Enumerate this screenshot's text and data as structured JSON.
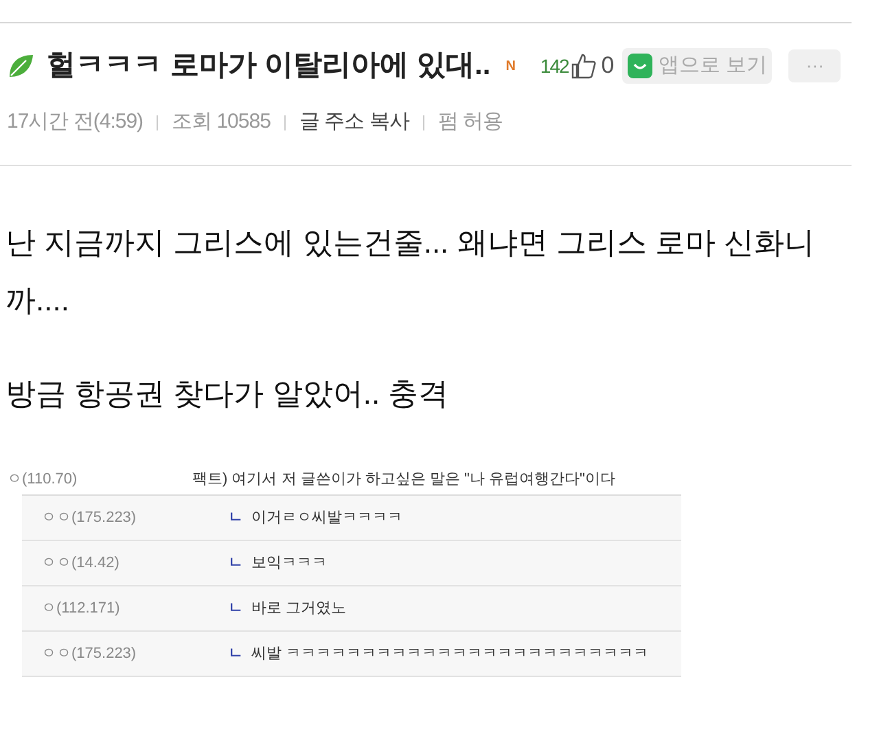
{
  "post": {
    "title": "헐ㅋㅋㅋ 로마가 이탈리아에 있대..",
    "new_badge": "N",
    "like_count": "142",
    "dislike_count": "0",
    "app_button": "앱으로 보기",
    "more_button": "···",
    "meta": [
      {
        "text": "17시간 전(4:59)",
        "kind": "plain"
      },
      {
        "text": "조회 10585",
        "kind": "plain"
      },
      {
        "text": "글 주소 복사",
        "kind": "link"
      },
      {
        "text": "펌 허용",
        "kind": "plain"
      }
    ],
    "body": [
      "난 지금까지 그리스에 있는건줄... 왜냐면 그리스 로마 신화니까....",
      "방금 항공권 찾다가 알았어.. 충격"
    ]
  },
  "comments": {
    "top": {
      "author": "ㅇ(110.70)",
      "text": "팩트) 여기서 저 글쓴이가 하고싶은 말은 \"나 유럽여행간다\"이다"
    },
    "replies": [
      {
        "author": "ㅇㅇ(175.223)",
        "marker": "ㄴ",
        "text": "이거ㄹㅇ씨발ㅋㅋㅋㅋ"
      },
      {
        "author": "ㅇㅇ(14.42)",
        "marker": "ㄴ",
        "text": "보익ㅋㅋㅋ"
      },
      {
        "author": "ㅇ(112.171)",
        "marker": "ㄴ",
        "text": "바로 그거였노"
      },
      {
        "author": "ㅇㅇ(175.223)",
        "marker": "ㄴ",
        "text": "씨발 ㅋㅋㅋㅋㅋㅋㅋㅋㅋㅋㅋㅋㅋㅋㅋㅋㅋㅋㅋㅋㅋㅋㅋㅋ"
      }
    ]
  }
}
